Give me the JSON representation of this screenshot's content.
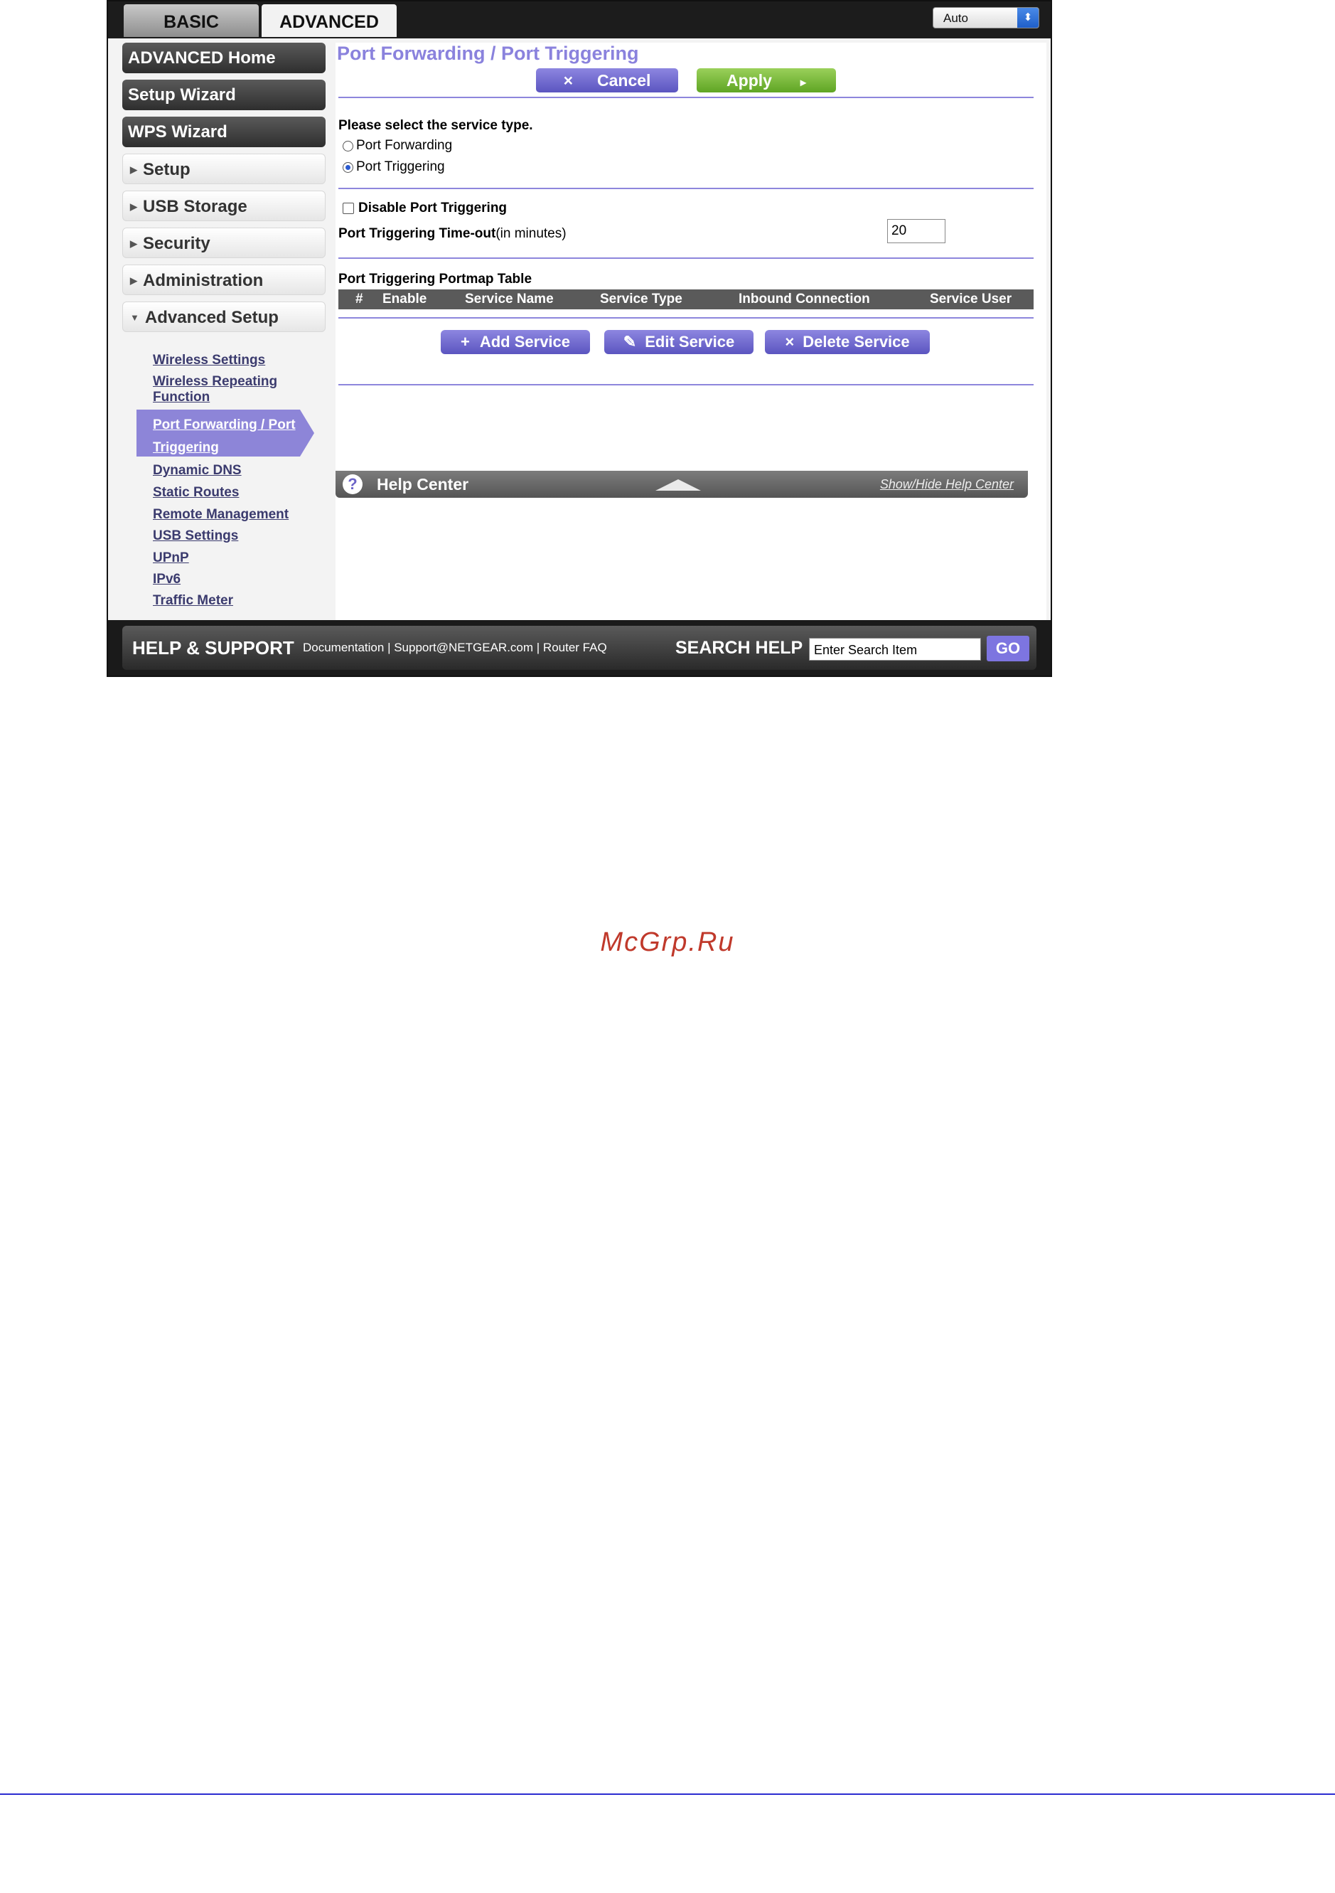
{
  "tabs": {
    "basic": "BASIC",
    "advanced": "ADVANCED"
  },
  "language": {
    "value": "Auto",
    "arrow": "⬍"
  },
  "sidebar": {
    "advanced_home": "ADVANCED Home",
    "setup_wizard": "Setup Wizard",
    "wps_wizard": "WPS Wizard",
    "setup": "Setup",
    "usb_storage": "USB Storage",
    "security": "Security",
    "administration": "Administration",
    "advanced_setup": "Advanced Setup",
    "collapsed_marker": "▶",
    "expanded_marker": "▼",
    "sublinks": {
      "wireless_settings": "Wireless Settings",
      "wireless_repeating": "Wireless Repeating Function",
      "port_forwarding": "Port Forwarding / Port Triggering",
      "dynamic_dns": "Dynamic DNS",
      "static_routes": "Static Routes",
      "remote_management": "Remote Management",
      "usb_settings": "USB Settings",
      "upnp": "UPnP",
      "ipv6": "IPv6",
      "traffic_meter": "Traffic Meter"
    }
  },
  "main": {
    "title": "Port Forwarding / Port Triggering",
    "cancel_label": "Cancel",
    "cancel_icon": "×",
    "apply_label": "Apply",
    "apply_icon": "▸",
    "service_type_prompt": "Please select the service type.",
    "radio_port_forwarding": "Port Forwarding",
    "radio_port_triggering": "Port Triggering",
    "selected_service_type": "Port Triggering",
    "disable_port_triggering": "Disable Port Triggering",
    "timeout_label_bold": "Port Triggering Time-out",
    "timeout_label_rest": "(in minutes)",
    "timeout_value": "20",
    "table_title": "Port Triggering Portmap Table",
    "table_columns": [
      "#",
      "Enable",
      "Service Name",
      "Service Type",
      "Inbound Connection",
      "Service User"
    ],
    "add_service": "Add Service",
    "add_icon": "+",
    "edit_service": "Edit Service",
    "edit_icon": "✎",
    "delete_service": "Delete Service",
    "delete_icon": "×"
  },
  "help_center": {
    "icon": "?",
    "title": "Help Center",
    "show_hide": "Show/Hide Help Center"
  },
  "footer": {
    "title": "HELP & SUPPORT",
    "documentation": "Documentation",
    "separator": " | ",
    "support": "Support@NETGEAR.com",
    "router_faq": "Router FAQ",
    "search_label": "SEARCH HELP",
    "search_value": "Enter Search Item",
    "go": "GO"
  },
  "watermark": "McGrp.Ru",
  "colors": {
    "accent": "#8a82dd",
    "apply_green": "#6fb22e",
    "watermark_red": "#c0392b",
    "rule_blue": "#2b2bd0"
  }
}
